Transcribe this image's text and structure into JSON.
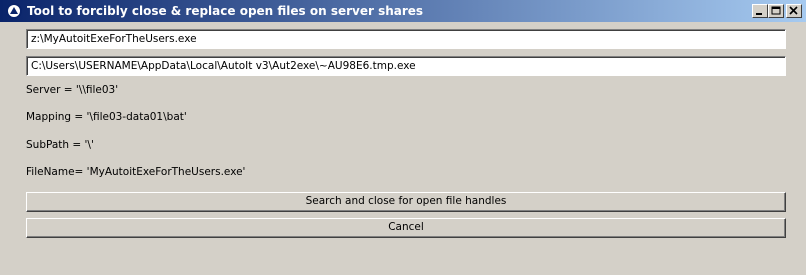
{
  "window": {
    "title": "Tool to forcibly close & replace open files on server shares",
    "icon": "autoit-icon",
    "controls": [
      "minimize-icon",
      "maximize-icon",
      "close-icon"
    ]
  },
  "fields": {
    "target_path": "z:\\MyAutoitExeForTheUsers.exe",
    "source_path": "C:\\Users\\USERNAME\\AppData\\Local\\AutoIt v3\\Aut2exe\\~AU98E6.tmp.exe"
  },
  "info": {
    "server": "Server  = '\\\\file03'",
    "mapping": "Mapping = '\\file03-data01\\bat'",
    "subpath": "SubPath = '\\'",
    "filename": "FileName= 'MyAutoitExeForTheUsers.exe'"
  },
  "buttons": {
    "search_label": "Search and close for open file handles",
    "cancel_label": "Cancel"
  },
  "colors": {
    "titlebar_start": "#0a246a",
    "titlebar_end": "#a6caf0",
    "face": "#d4d0c8"
  }
}
